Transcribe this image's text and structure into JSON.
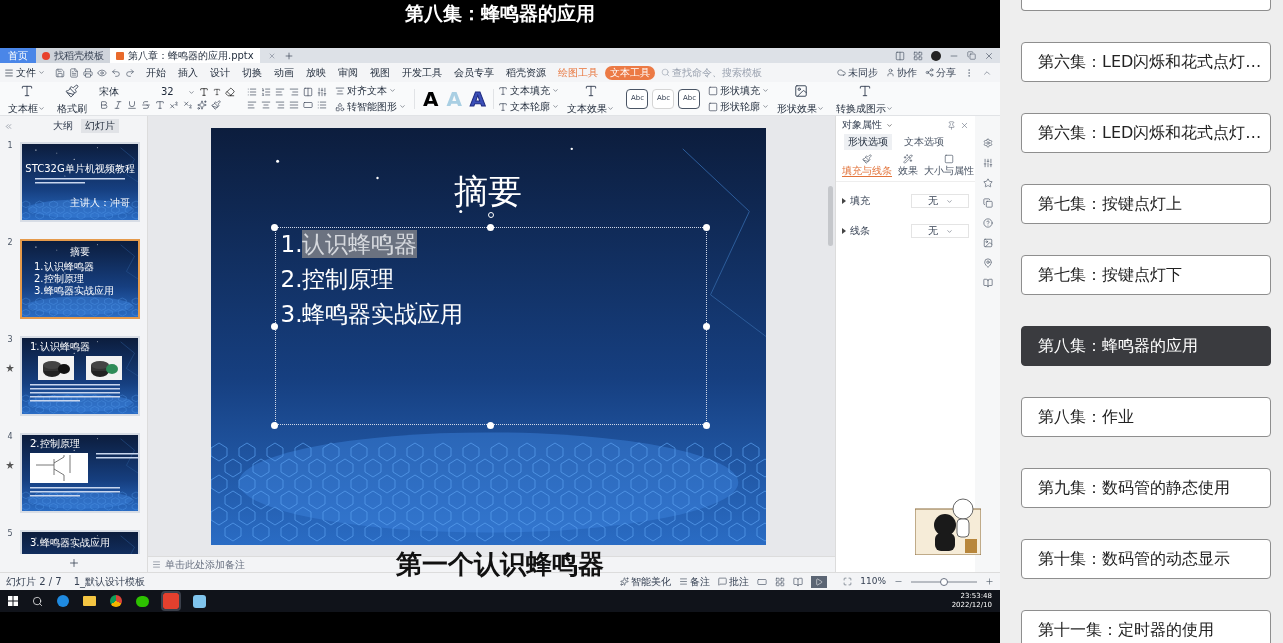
{
  "video": {
    "title": "第八集：蜂鸣器的应用",
    "caption": "第一个认识蜂鸣器"
  },
  "tabs": [
    {
      "label": "首页",
      "kind": "home",
      "selected": false
    },
    {
      "label": "找稻壳模板",
      "kind": "template",
      "selected": false
    },
    {
      "label": "第八章：蜂鸣器的应用.pptx",
      "kind": "file",
      "selected": true
    }
  ],
  "menu": {
    "file": "文件",
    "items": [
      {
        "label": "开始",
        "kind": "main",
        "selected": false
      },
      {
        "label": "插入",
        "kind": "main",
        "selected": false
      },
      {
        "label": "设计",
        "kind": "main",
        "selected": false
      },
      {
        "label": "切换",
        "kind": "main",
        "selected": false
      },
      {
        "label": "动画",
        "kind": "main",
        "selected": false
      },
      {
        "label": "放映",
        "kind": "main",
        "selected": false
      },
      {
        "label": "审阅",
        "kind": "main",
        "selected": false
      },
      {
        "label": "视图",
        "kind": "main",
        "selected": false
      },
      {
        "label": "开发工具",
        "kind": "main",
        "selected": false
      },
      {
        "label": "会员专享",
        "kind": "main",
        "selected": false
      },
      {
        "label": "稻壳资源",
        "kind": "main",
        "selected": false
      },
      {
        "label": "绘图工具",
        "kind": "context",
        "selected": false
      },
      {
        "label": "文本工具",
        "kind": "context",
        "selected": true
      }
    ],
    "search": {
      "placeholder": "查找命令、搜索模板"
    },
    "actions": [
      "未同步",
      "协作",
      "分享"
    ]
  },
  "ribbon": {
    "text_box": "文本框",
    "format_painter": "格式刷",
    "font": "宋体",
    "size": "32",
    "align_text": "对齐文本",
    "smart_art": "转智能图形",
    "samples": [
      {
        "label": "A",
        "color": "#000000"
      },
      {
        "label": "A",
        "color": "#a9cfe3"
      },
      {
        "label": "A",
        "color": "#3b4fb8"
      }
    ],
    "text_fill": "文本填充",
    "text_outline": "文本轮廓",
    "text_effect": "文本效果",
    "shape_styles": [
      "Abc",
      "Abc",
      "Abc"
    ],
    "shape_fill": "形状填充",
    "shape_outline": "形状轮廓",
    "shape_effect": "形状效果",
    "convert": "转换成图示"
  },
  "panel_tabs": [
    {
      "label": "大纲",
      "selected": false
    },
    {
      "label": "幻灯片",
      "selected": true
    }
  ],
  "slides": [
    {
      "number": "1",
      "kind": "cover",
      "title": "STC32G单片机视频教程",
      "lines": [
        "主讲人：冲哥"
      ],
      "selected": false,
      "animated": false
    },
    {
      "number": "2",
      "kind": "list",
      "title": "摘要",
      "lines": [
        "1.认识蜂鸣器",
        "2.控制原理",
        "3.蜂鸣器实战应用"
      ],
      "selected": true,
      "animated": false
    },
    {
      "number": "3",
      "kind": "photos",
      "title": "1.认识蜂鸣器",
      "selected": false,
      "animated": true
    },
    {
      "number": "4",
      "kind": "diagram",
      "title": "2.控制原理",
      "selected": false,
      "animated": true
    },
    {
      "number": "5",
      "kind": "partial",
      "title": "3.蜂鸣器实战应用",
      "selected": false,
      "animated": false
    }
  ],
  "current_slide": {
    "title": "摘要",
    "items": [
      {
        "number": "1.",
        "text": "认识蜂鸣器",
        "selected": true
      },
      {
        "number": "2.",
        "text": "控制原理",
        "selected": false
      },
      {
        "number": "3.",
        "text": "蜂鸣器实战应用",
        "selected": false
      }
    ]
  },
  "properties": {
    "title": "对象属性",
    "tabs": [
      {
        "label": "形状选项",
        "selected": true
      },
      {
        "label": "文本选项",
        "selected": false
      }
    ],
    "subtabs": [
      {
        "label": "填充与线条",
        "selected": true
      },
      {
        "label": "效果",
        "selected": false
      },
      {
        "label": "大小与属性",
        "selected": false
      }
    ],
    "rows": [
      {
        "label": "填充",
        "value": "无"
      },
      {
        "label": "线条",
        "value": "无"
      }
    ]
  },
  "notes": {
    "placeholder": "单击此处添加备注"
  },
  "status": {
    "slide": "幻灯片 2 / 7",
    "template": "1_默认设计模板",
    "actions": [
      "智能美化",
      "备注",
      "批注"
    ],
    "zoom": "110%",
    "zoom_slider": {
      "level": 0.5
    }
  },
  "taskbar": {
    "time": "23:53:48",
    "date": "2022/12/10"
  },
  "playlist": [
    {
      "title": "第六集：LED闪烁和花式点灯…",
      "selected": false
    },
    {
      "title": "第六集：LED闪烁和花式点灯…",
      "selected": false
    },
    {
      "title": "第七集：按键点灯上",
      "selected": false
    },
    {
      "title": "第七集：按键点灯下",
      "selected": false
    },
    {
      "title": "第八集：蜂鸣器的应用",
      "selected": true
    },
    {
      "title": "第八集：作业",
      "selected": false
    },
    {
      "title": "第九集：数码管的静态使用",
      "selected": false
    },
    {
      "title": "第十集：数码管的动态显示",
      "selected": false
    },
    {
      "title": "第十一集：定时器的使用",
      "selected": false
    }
  ]
}
